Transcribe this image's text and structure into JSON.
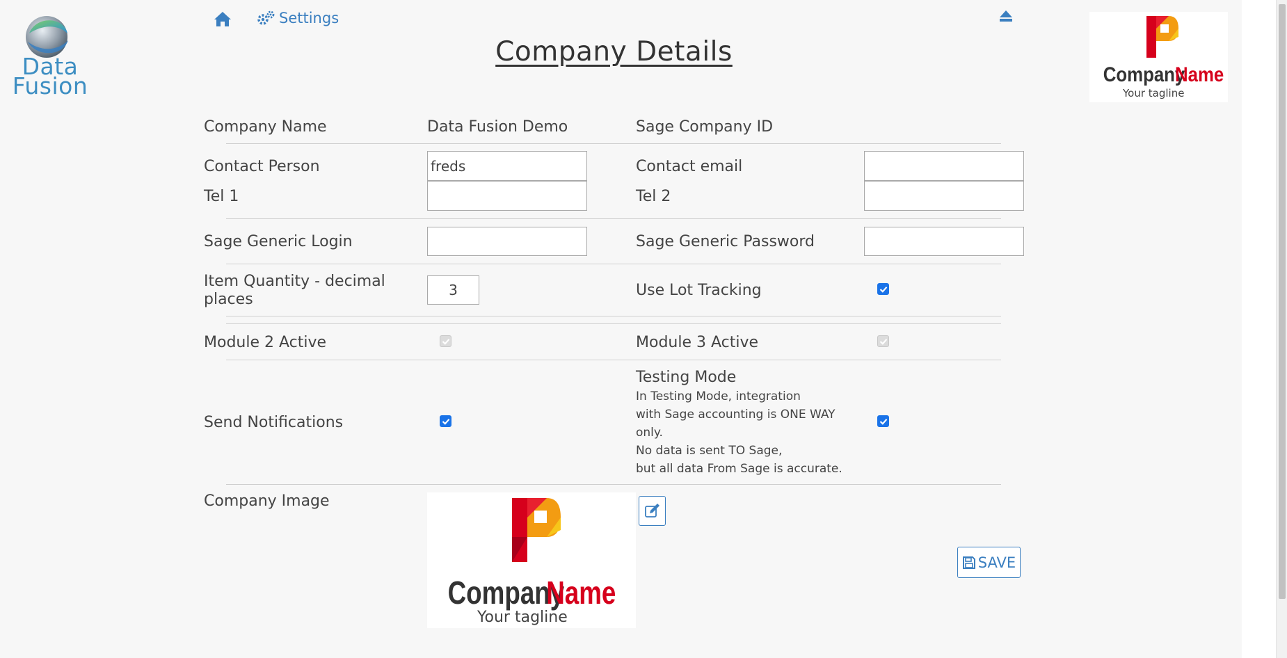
{
  "brand": {
    "line1": "Data",
    "line2": "Fusion"
  },
  "nav": {
    "settings_label": "Settings"
  },
  "page_title": "Company Details",
  "logo": {
    "word1": "Company",
    "word2": "Name",
    "tagline": "Your tagline"
  },
  "form": {
    "company_name_label": "Company Name",
    "company_name_value": "Data Fusion Demo",
    "sage_company_id_label": "Sage Company ID",
    "contact_person_label": "Contact Person",
    "contact_person_value": "freds",
    "contact_email_label": "Contact email",
    "contact_email_value": "",
    "tel1_label": "Tel 1",
    "tel1_value": "",
    "tel2_label": "Tel 2",
    "tel2_value": "",
    "sage_login_label": "Sage Generic Login",
    "sage_login_value": "",
    "sage_password_label": "Sage Generic Password",
    "sage_password_value": "",
    "item_qty_label_1": "Item Quantity - decimal",
    "item_qty_label_2": "places",
    "item_qty_value": "3",
    "lot_tracking_label": "Use Lot Tracking",
    "lot_tracking_checked": true,
    "module2_label": "Module 2 Active",
    "module2_checked": true,
    "module3_label": "Module 3 Active",
    "module3_checked": true,
    "send_notifications_label": "Send Notifications",
    "send_notifications_checked": true,
    "testing_mode_label": "Testing Mode",
    "testing_mode_desc": [
      "In Testing Mode, integration",
      "with Sage accounting is ONE WAY",
      "only.",
      "No data is sent TO Sage,",
      "but all data From Sage is accurate."
    ],
    "testing_mode_checked": true,
    "company_image_label": "Company Image"
  },
  "actions": {
    "save_label": "SAVE"
  },
  "colors": {
    "accent": "#3b7fc0",
    "brand": "#3d8ec2",
    "checkbox": "#1a73e8",
    "logo_red": "#d6001c"
  }
}
